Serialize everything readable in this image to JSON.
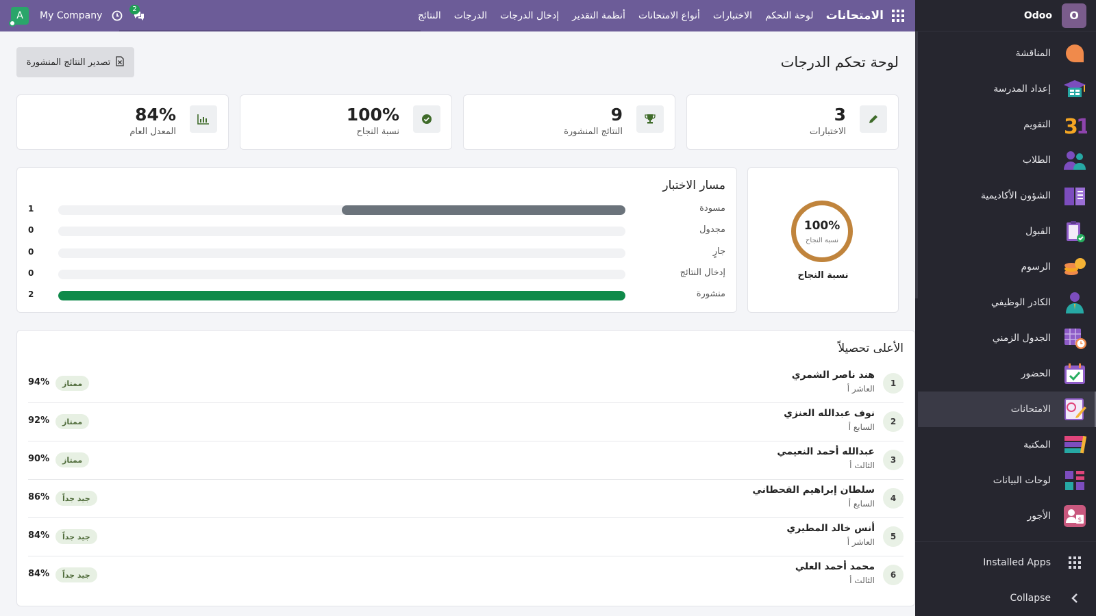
{
  "brand": {
    "name": "Odoo",
    "logo_letter": "O"
  },
  "sidebar": {
    "items": [
      {
        "label": "المناقشة",
        "icon": "discuss-icon",
        "active": false
      },
      {
        "label": "إعداد المدرسة",
        "icon": "graduation-cap-icon",
        "active": false
      },
      {
        "label": "التقويم",
        "icon": "calendar-31-icon",
        "active": false
      },
      {
        "label": "الطلاب",
        "icon": "students-icon",
        "active": false
      },
      {
        "label": "الشؤون الأكاديمية",
        "icon": "book-icon",
        "active": false
      },
      {
        "label": "القبول",
        "icon": "clipboard-check-icon",
        "active": false
      },
      {
        "label": "الرسوم",
        "icon": "coins-icon",
        "active": false
      },
      {
        "label": "الكادر الوظيفي",
        "icon": "staff-icon",
        "active": false
      },
      {
        "label": "الجدول الزمني",
        "icon": "timetable-icon",
        "active": false
      },
      {
        "label": "الحضور",
        "icon": "attendance-icon",
        "active": false
      },
      {
        "label": "الامتحانات",
        "icon": "exam-icon",
        "active": true
      },
      {
        "label": "المكتبة",
        "icon": "library-icon",
        "active": false
      },
      {
        "label": "لوحات البيانات",
        "icon": "dashboards-icon",
        "active": false
      },
      {
        "label": "الأجور",
        "icon": "payroll-icon",
        "active": false
      }
    ],
    "installed_apps": "Installed Apps",
    "collapse": "Collapse"
  },
  "topbar": {
    "app_title": "الامتحانات",
    "menu": [
      "لوحة التحكم",
      "الاختبارات",
      "أنواع الامتحانات",
      "أنظمة التقدير",
      "إدخال الدرجات",
      "الدرجات",
      "النتائج"
    ],
    "company": "My Company",
    "user_initial": "A",
    "chat_badge": "2"
  },
  "page": {
    "title": "لوحة تحكم الدرجات",
    "export_label": "تصدير النتائج المنشورة"
  },
  "kpis": [
    {
      "value": "3",
      "label": "الاختبارات",
      "icon": "pencil-icon",
      "color": "#3f6b2a"
    },
    {
      "value": "9",
      "label": "النتائج المنشورة",
      "icon": "trophy-icon",
      "color": "#3f6b2a"
    },
    {
      "value": "100%",
      "label": "نسبة النجاح",
      "icon": "check-circle-icon",
      "color": "#3f6b2a"
    },
    {
      "value": "84%",
      "label": "المعدل العام",
      "icon": "bar-chart-icon",
      "color": "#3f6b2a"
    }
  ],
  "pass_rate": {
    "value": "100%",
    "sub": "نسبة النجاح",
    "title": "نسبة النجاح",
    "ring_color": "#c0843c",
    "fraction": 1.0
  },
  "pipeline": {
    "title": "مسار الاختبار",
    "stages": [
      {
        "label": "مسودة",
        "count": 1,
        "color": "#6b737b"
      },
      {
        "label": "مجدول",
        "count": 0,
        "color": "#6b737b"
      },
      {
        "label": "جارٍ",
        "count": 0,
        "color": "#6b737b"
      },
      {
        "label": "إدخال النتائج",
        "count": 0,
        "color": "#6b737b"
      },
      {
        "label": "منشورة",
        "count": 2,
        "color": "#0f8a4a"
      }
    ],
    "max": 2
  },
  "top_students": {
    "title": "الأعلى تحصيلاً",
    "rows": [
      {
        "rank": "1",
        "name": "هند ناصر الشمري",
        "class": "العاشر أ",
        "grade": "ممتاز",
        "score": "94%"
      },
      {
        "rank": "2",
        "name": "نوف عبدالله العنزي",
        "class": "السابع أ",
        "grade": "ممتاز",
        "score": "92%"
      },
      {
        "rank": "3",
        "name": "عبدالله أحمد النعيمي",
        "class": "الثالث أ",
        "grade": "ممتاز",
        "score": "90%"
      },
      {
        "rank": "4",
        "name": "سلطان إبراهيم القحطاني",
        "class": "السابع أ",
        "grade": "جيد جداً",
        "score": "86%"
      },
      {
        "rank": "5",
        "name": "أنس خالد المطيري",
        "class": "العاشر أ",
        "grade": "جيد جداً",
        "score": "84%"
      },
      {
        "rank": "6",
        "name": "محمد أحمد العلي",
        "class": "الثالث أ",
        "grade": "جيد جداً",
        "score": "84%"
      }
    ]
  }
}
